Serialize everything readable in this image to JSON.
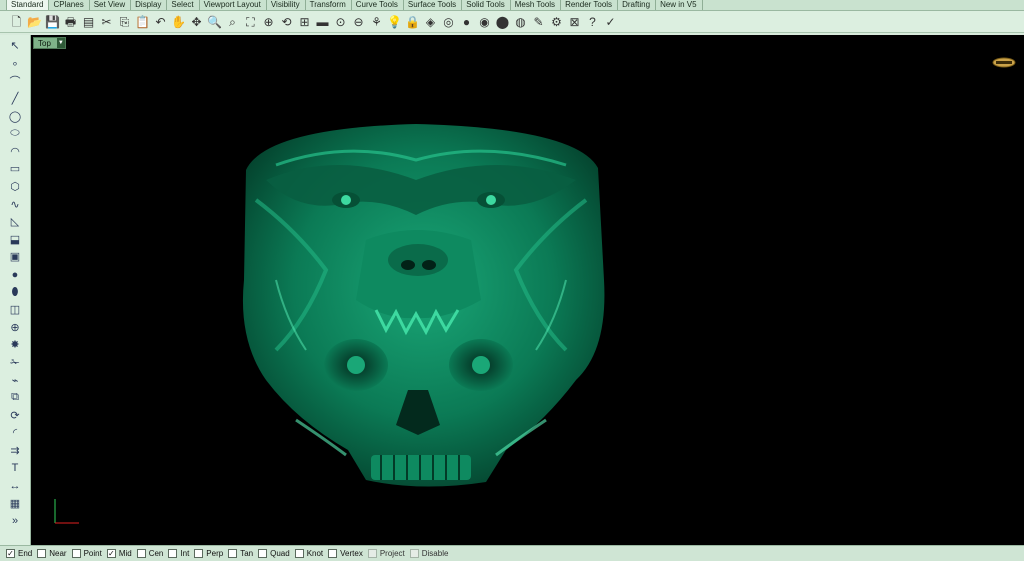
{
  "tabs": [
    {
      "label": "Standard",
      "active": true
    },
    {
      "label": "CPlanes"
    },
    {
      "label": "Set View"
    },
    {
      "label": "Display"
    },
    {
      "label": "Select"
    },
    {
      "label": "Viewport Layout"
    },
    {
      "label": "Visibility"
    },
    {
      "label": "Transform"
    },
    {
      "label": "Curve Tools"
    },
    {
      "label": "Surface Tools"
    },
    {
      "label": "Solid Tools"
    },
    {
      "label": "Mesh Tools"
    },
    {
      "label": "Render Tools"
    },
    {
      "label": "Drafting"
    },
    {
      "label": "New in V5"
    }
  ],
  "toolbar_icons": [
    {
      "name": "new-file-icon",
      "glyph": "🗋"
    },
    {
      "name": "open-folder-icon",
      "glyph": "📂"
    },
    {
      "name": "save-icon",
      "glyph": "💾"
    },
    {
      "name": "print-icon",
      "glyph": "🖶"
    },
    {
      "name": "import-icon",
      "glyph": "▤"
    },
    {
      "name": "cut-icon",
      "glyph": "✂"
    },
    {
      "name": "copy-icon",
      "glyph": "⎘"
    },
    {
      "name": "paste-icon",
      "glyph": "📋"
    },
    {
      "name": "undo-icon",
      "glyph": "↶"
    },
    {
      "name": "pan-hand-icon",
      "glyph": "✋"
    },
    {
      "name": "move-view-icon",
      "glyph": "✥"
    },
    {
      "name": "zoom-icon",
      "glyph": "🔍"
    },
    {
      "name": "zoom-window-icon",
      "glyph": "⌕"
    },
    {
      "name": "zoom-extents-icon",
      "glyph": "⛶"
    },
    {
      "name": "zoom-selected-icon",
      "glyph": "⊕"
    },
    {
      "name": "rotate-view-icon",
      "glyph": "⟲"
    },
    {
      "name": "four-viewports-icon",
      "glyph": "⊞"
    },
    {
      "name": "cplane-icon",
      "glyph": "▬"
    },
    {
      "name": "grid-snap-icon",
      "glyph": "⊙"
    },
    {
      "name": "ortho-icon",
      "glyph": "⊖"
    },
    {
      "name": "select-icon",
      "glyph": "⚘"
    },
    {
      "name": "light-icon",
      "glyph": "💡"
    },
    {
      "name": "lock-icon",
      "glyph": "🔒"
    },
    {
      "name": "layers-icon",
      "glyph": "◈"
    },
    {
      "name": "color-wheel-icon",
      "glyph": "◎"
    },
    {
      "name": "render-sphere-icon",
      "glyph": "●"
    },
    {
      "name": "shaded-sphere-icon",
      "glyph": "◉"
    },
    {
      "name": "material-sphere-icon",
      "glyph": "⬤"
    },
    {
      "name": "environment-sphere-icon",
      "glyph": "◍"
    },
    {
      "name": "properties-icon",
      "glyph": "✎"
    },
    {
      "name": "settings-gear-icon",
      "glyph": "⚙"
    },
    {
      "name": "grid-icon",
      "glyph": "⊠"
    },
    {
      "name": "help-icon",
      "glyph": "?"
    },
    {
      "name": "options-icon",
      "glyph": "✓"
    }
  ],
  "left_icons": [
    "select-arrow-icon",
    "point-icon",
    "polyline-icon",
    "line-icon",
    "circle-icon",
    "ellipse-icon",
    "arc-icon",
    "rectangle-icon",
    "polygon-icon",
    "curve-icon",
    "surface-icon",
    "extrude-icon",
    "box-icon",
    "sphere-icon",
    "cylinder-icon",
    "mesh-icon",
    "solid-tools-icon",
    "explode-icon",
    "trim-icon",
    "split-icon",
    "group-icon",
    "transform-icon",
    "fillet-icon",
    "offset-icon",
    "text-icon",
    "dimension-icon",
    "block-icon",
    "more-icon"
  ],
  "left_glyphs": [
    "↖",
    "∘",
    "⌒",
    "╱",
    "◯",
    "⬭",
    "◠",
    "▭",
    "⬡",
    "∿",
    "◺",
    "⬓",
    "▣",
    "●",
    "⬮",
    "◫",
    "⊕",
    "✸",
    "✁",
    "⌁",
    "⧉",
    "⟳",
    "◜",
    "⇉",
    "T",
    "↔",
    "▦",
    "»"
  ],
  "viewport": {
    "label": "Top",
    "background": "#000000",
    "model_color": "#0d7a55"
  },
  "osnaps": [
    {
      "label": "End",
      "checked": true
    },
    {
      "label": "Near",
      "checked": false
    },
    {
      "label": "Point",
      "checked": false
    },
    {
      "label": "Mid",
      "checked": true
    },
    {
      "label": "Cen",
      "checked": false
    },
    {
      "label": "Int",
      "checked": false
    },
    {
      "label": "Perp",
      "checked": false
    },
    {
      "label": "Tan",
      "checked": false
    },
    {
      "label": "Quad",
      "checked": false
    },
    {
      "label": "Knot",
      "checked": false
    },
    {
      "label": "Vertex",
      "checked": false
    },
    {
      "label": "Project",
      "checked": false,
      "disabled": true
    },
    {
      "label": "Disable",
      "checked": false,
      "disabled": true
    }
  ]
}
